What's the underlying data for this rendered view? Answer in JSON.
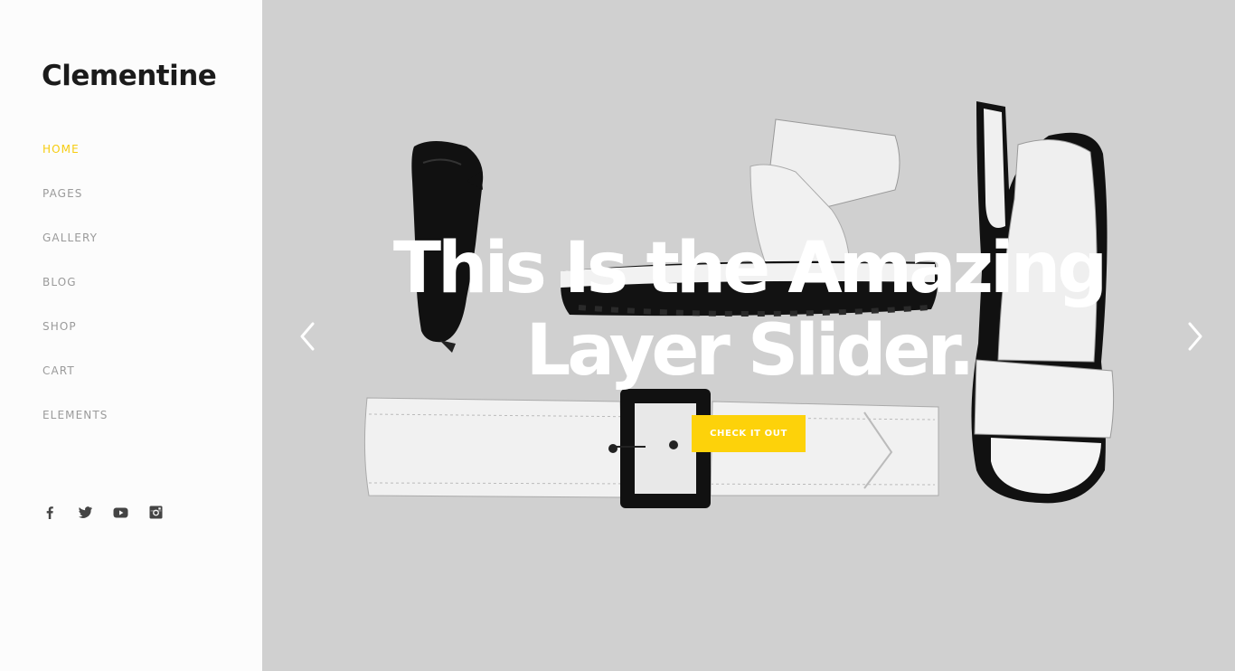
{
  "brand": {
    "name": "Clementine"
  },
  "nav": {
    "items": [
      {
        "label": "HOME",
        "active": true
      },
      {
        "label": "PAGES",
        "active": false
      },
      {
        "label": "GALLERY",
        "active": false
      },
      {
        "label": "BLOG",
        "active": false
      },
      {
        "label": "SHOP",
        "active": false
      },
      {
        "label": "CART",
        "active": false
      },
      {
        "label": "ELEMENTS",
        "active": false
      }
    ]
  },
  "social": [
    "facebook-icon",
    "twitter-icon",
    "youtube-icon",
    "instagram-icon"
  ],
  "slider": {
    "headline_line1": "This Is the Amazing",
    "headline_line2": "Layer Slider.",
    "cta_label": "CHECK IT OUT",
    "prev_icon": "chevron-left-icon",
    "next_icon": "chevron-right-icon"
  },
  "colors": {
    "accent": "#f6cc0f",
    "button": "#fdd20a",
    "slider_background": "#d0d0d0",
    "nav_text": "#9a9a9a",
    "logo_text": "#1b1b1b"
  }
}
